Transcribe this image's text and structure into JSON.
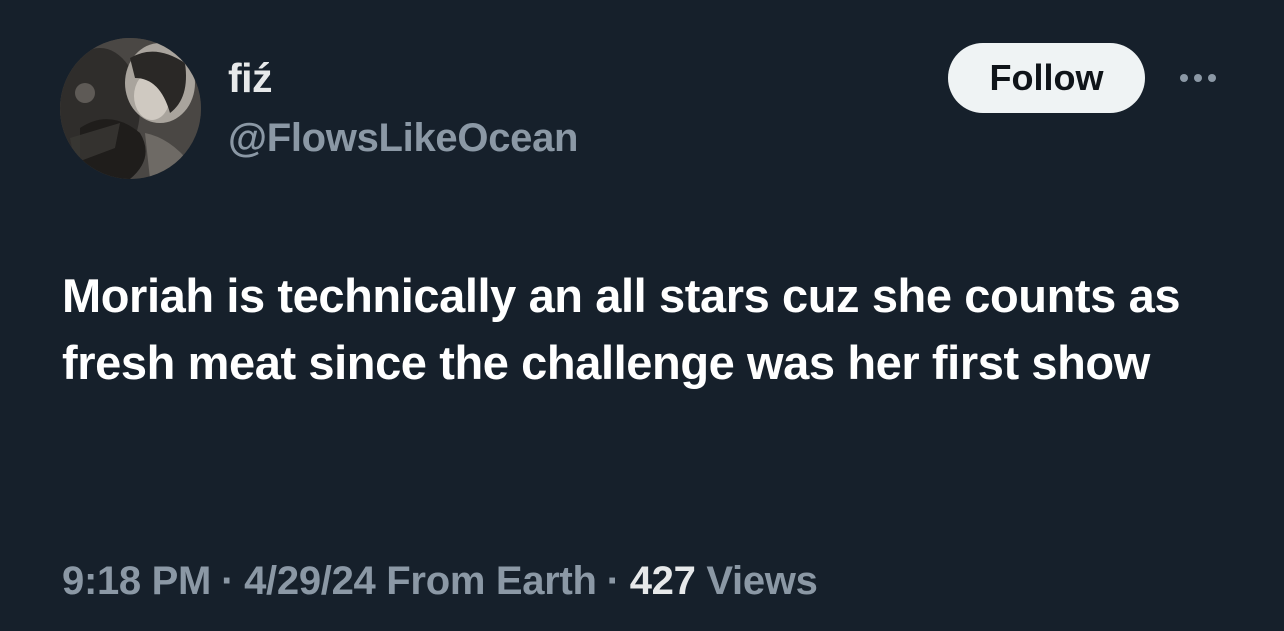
{
  "user": {
    "display_name": "fiź",
    "handle": "@FlowsLikeOcean",
    "avatar": "avatar-photo"
  },
  "actions": {
    "follow_label": "Follow",
    "more_icon": "more-dots-icon"
  },
  "tweet": {
    "text": "Moriah is technically an all stars cuz she counts as fresh meat since the challenge was her first show"
  },
  "meta": {
    "time": "9:18 PM",
    "separator": "·",
    "date": "4/29/24",
    "source": "From Earth",
    "views_count": "427",
    "views_label": "Views"
  },
  "colors": {
    "background": "#16202b",
    "primary_text": "#e7e9ea",
    "secondary_text": "#8b98a5",
    "button_bg": "#eff3f4",
    "button_text": "#0f1419"
  }
}
